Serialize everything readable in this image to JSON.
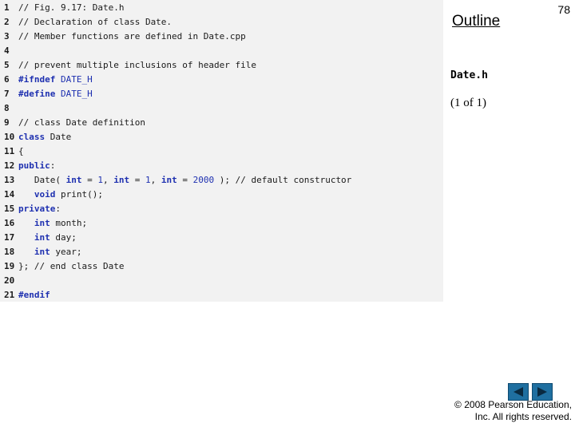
{
  "slide": {
    "outline_title": "Outline",
    "page_number": "78",
    "file_name": "Date.h",
    "page_of": "(1 of 1)"
  },
  "code": {
    "lines": [
      {
        "num": "1",
        "text": "// Fig. 9.17: Date.h"
      },
      {
        "num": "2",
        "text": "// Declaration of class Date."
      },
      {
        "num": "3",
        "text": "// Member functions are defined in Date.cpp"
      },
      {
        "num": "4",
        "text": ""
      },
      {
        "num": "5",
        "text": "// prevent multiple inclusions of header file"
      },
      {
        "num": "6",
        "text": "#ifndef DATE_H"
      },
      {
        "num": "7",
        "text": "#define DATE_H"
      },
      {
        "num": "8",
        "text": ""
      },
      {
        "num": "9",
        "text": "// class Date definition"
      },
      {
        "num": "10",
        "text": "class Date"
      },
      {
        "num": "11",
        "text": "{"
      },
      {
        "num": "12",
        "text": "public:"
      },
      {
        "num": "13",
        "text": "   Date( int = 1, int = 1, int = 2000 ); // default constructor"
      },
      {
        "num": "14",
        "text": "   void print();"
      },
      {
        "num": "15",
        "text": "private:"
      },
      {
        "num": "16",
        "text": "   int month;"
      },
      {
        "num": "17",
        "text": "   int day;"
      },
      {
        "num": "18",
        "text": "   int year;"
      },
      {
        "num": "19",
        "text": "}; // end class Date"
      },
      {
        "num": "20",
        "text": ""
      },
      {
        "num": "21",
        "text": "#endif"
      }
    ]
  },
  "footer": {
    "copyright_line1": "© 2008 Pearson Education,",
    "copyright_line2": "Inc.  All rights reserved."
  },
  "nav": {
    "prev_icon": "triangle-left-icon",
    "next_icon": "triangle-right-icon"
  },
  "colors": {
    "keyword": "#1e30b0",
    "panel_bg": "#f2f2f2",
    "nav_button": "#1f6fa0"
  }
}
